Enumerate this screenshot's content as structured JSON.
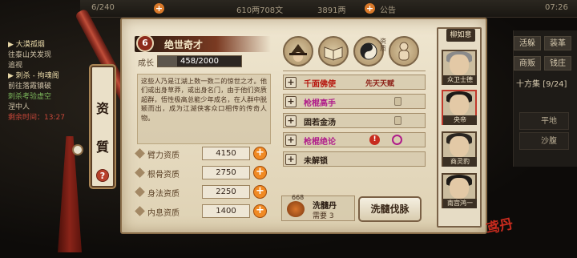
{
  "topbar": {
    "capacity": "6/240",
    "money": "610两708文",
    "currency2": "3891两",
    "announce": "公告",
    "time": "07:26"
  },
  "quests": [
    {
      "text": "▶ 大漠孤烟",
      "cls": "hl"
    },
    {
      "text": "往泰山关发现",
      "cls": ""
    },
    {
      "text": "追视",
      "cls": ""
    },
    {
      "text": "▶ 刺杀 - 拘魂阁",
      "cls": "hl"
    },
    {
      "text": "前往落霞镇破",
      "cls": ""
    },
    {
      "text": "刺杀考验虚空",
      "cls": "grn"
    },
    {
      "text": "涅中人",
      "cls": ""
    },
    {
      "text": "剩余时间：13:27",
      "cls": "red"
    }
  ],
  "right_menu": {
    "buttons": [
      "活躲",
      "装革",
      "商贩",
      "钱庄"
    ],
    "counter": "十方集",
    "counter_val": "[9/24]",
    "terrain1": "平地",
    "terrain2": "沙腹"
  },
  "scroll_tab": {
    "chars": [
      "资",
      "質"
    ],
    "help": "?"
  },
  "character": {
    "name": "绝世奇才",
    "growth_label": "成长",
    "growth_text": "458/2000",
    "growth_ratio": 0.229,
    "description": "这些人乃是江湖上数一数二的惊世之才。他们或出身草莽，或出身名门，由于他们资质超群，悟性极高总能少年成名，在人群中脱颖而出，成为江湖侠客众口相传的传奇人物。"
  },
  "attributes": [
    {
      "label": "臂力资质",
      "value": "4150"
    },
    {
      "label": "根骨资质",
      "value": "2750"
    },
    {
      "label": "身法资质",
      "value": "2250"
    },
    {
      "label": "内息资质",
      "value": "1400"
    }
  ],
  "skill_icons": [
    "hat-icon",
    "book-icon",
    "taiji-icon",
    "figure-icon"
  ],
  "skill_icon_label": "资质",
  "skills": [
    {
      "name": "千面佛使",
      "tag": "先天天赋",
      "color": "#b6140c",
      "lock": false
    },
    {
      "name": "枪棍高手",
      "tag": "",
      "color": "#b01c8a",
      "lock": true
    },
    {
      "name": "固若金汤",
      "tag": "",
      "color": "#2a1c12",
      "lock": true
    },
    {
      "name": "枪棍绝论",
      "tag": "",
      "color": "#b01c8a",
      "lock": false
    },
    {
      "name": "未解锁",
      "tag": "",
      "color": "#2a1c12",
      "lock": false
    }
  ],
  "item": {
    "count": "668",
    "name": "洗髓丹",
    "need": "需要 3"
  },
  "action_button": "洗髓伐脉",
  "character_list": {
    "tab": "柳如意",
    "chars": [
      {
        "name": "众卫士德"
      },
      {
        "name": "央帝"
      },
      {
        "name": "商灵豹"
      },
      {
        "name": "南宫鸿一"
      }
    ]
  },
  "logo_text": "鸢丹"
}
